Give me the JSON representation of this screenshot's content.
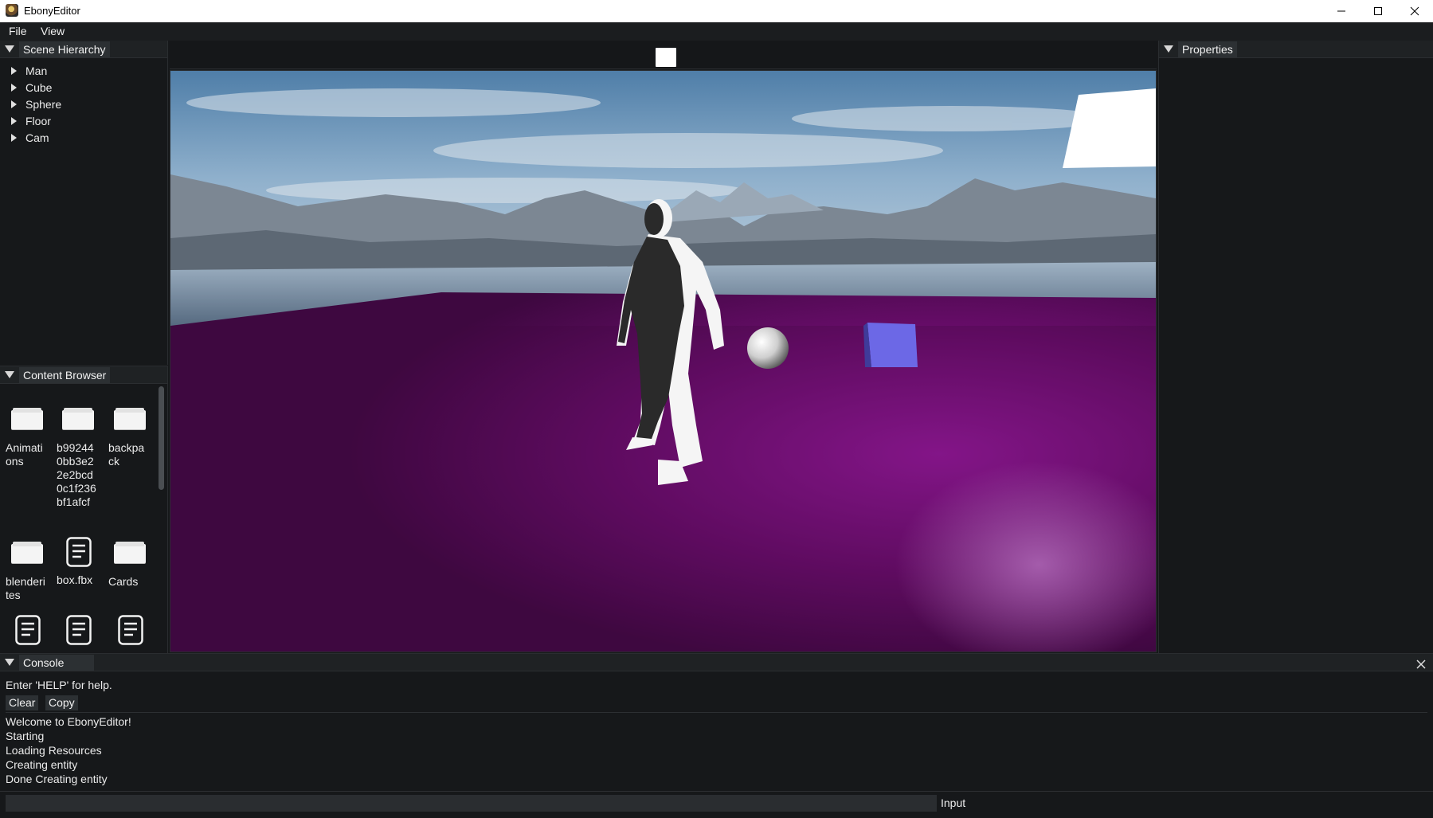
{
  "window": {
    "title": "EbonyEditor"
  },
  "menubar": {
    "items": [
      {
        "label": "File"
      },
      {
        "label": "View"
      }
    ]
  },
  "scene_hierarchy": {
    "title": "Scene Hierarchy",
    "items": [
      {
        "label": "Man"
      },
      {
        "label": "Cube"
      },
      {
        "label": "Sphere"
      },
      {
        "label": "Floor"
      },
      {
        "label": "Cam"
      }
    ]
  },
  "content_browser": {
    "title": "Content Browser",
    "items": [
      {
        "label": "Animations",
        "icon": "folder-icon"
      },
      {
        "label": "b992440bb3e22e2bcd0c1f236bf1afcf",
        "icon": "folder-icon"
      },
      {
        "label": "backpack",
        "icon": "folder-icon"
      },
      {
        "label": "blenderites",
        "icon": "folder-icon"
      },
      {
        "label": "box.fbx",
        "icon": "file-icon"
      },
      {
        "label": "Cards",
        "icon": "folder-icon"
      },
      {
        "label": "",
        "icon": "file-icon"
      },
      {
        "label": "",
        "icon": "file-icon"
      },
      {
        "label": "",
        "icon": "file-icon"
      }
    ]
  },
  "properties": {
    "title": "Properties"
  },
  "console": {
    "title": "Console",
    "help": "Enter 'HELP' for help.",
    "buttons": {
      "clear": "Clear",
      "copy": "Copy"
    },
    "lines": [
      "Welcome to EbonyEditor!",
      "Starting",
      "Loading Resources",
      "Creating entity",
      "Done Creating entity"
    ],
    "input_value": "",
    "input_label": "Input"
  },
  "colors": {
    "floor": "#5a0b5a",
    "sky": "#6d8fb5",
    "cube": "#6c68e6",
    "panel_bg": "#16181a"
  }
}
